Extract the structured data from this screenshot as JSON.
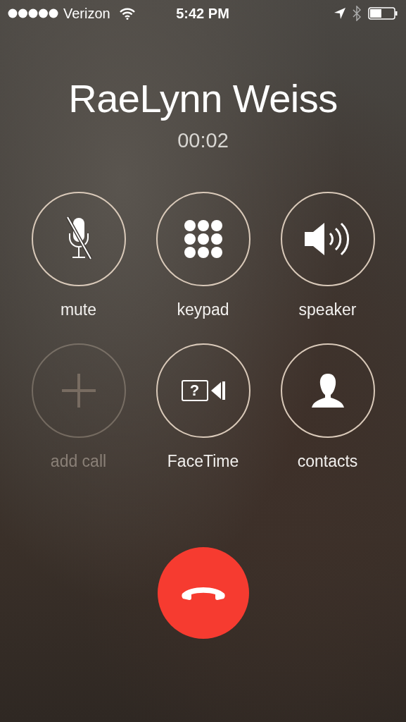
{
  "status_bar": {
    "carrier": "Verizon",
    "time": "5:42 PM"
  },
  "call": {
    "name": "RaeLynn Weiss",
    "duration": "00:02"
  },
  "controls": [
    {
      "kind": "mute",
      "label": "mute",
      "disabled": false
    },
    {
      "kind": "keypad",
      "label": "keypad",
      "disabled": false
    },
    {
      "kind": "speaker",
      "label": "speaker",
      "disabled": false
    },
    {
      "kind": "add",
      "label": "add call",
      "disabled": true
    },
    {
      "kind": "facetime",
      "label": "FaceTime",
      "disabled": false,
      "icon_text": "?"
    },
    {
      "kind": "contacts",
      "label": "contacts",
      "disabled": false
    }
  ]
}
